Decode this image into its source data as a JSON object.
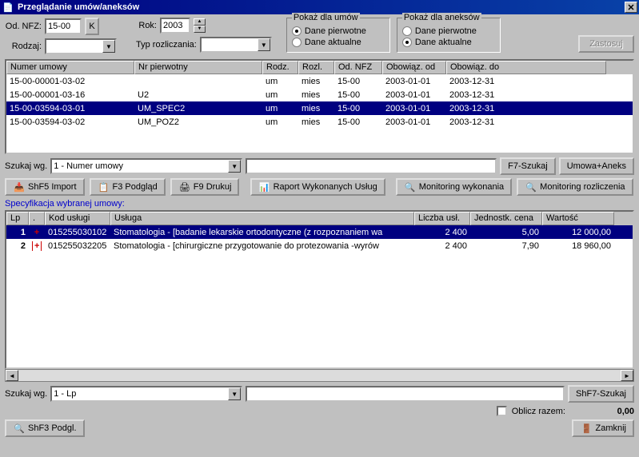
{
  "title": "Przeglądanie umów/aneksów",
  "filters": {
    "od_nfz_label": "Od. NFZ:",
    "od_nfz_value": "15-00",
    "od_nfz_btn": "K",
    "rok_label": "Rok:",
    "rok_value": "2003",
    "rodzaj_label": "Rodzaj:",
    "rodzaj_value": "",
    "typ_label": "Typ rozliczania:",
    "typ_value": ""
  },
  "umowy_box": {
    "legend": "Pokaż dla umów",
    "opt1": "Dane pierwotne",
    "opt2": "Dane aktualne"
  },
  "aneksy_box": {
    "legend": "Pokaż dla aneksów",
    "opt1": "Dane pierwotne",
    "opt2": "Dane aktualne"
  },
  "zastosuj": "Zastosuj",
  "grid1": {
    "headers": [
      "Numer umowy",
      "Nr pierwotny",
      "Rodz.",
      "Rozl.",
      "Od. NFZ",
      "Obowiąz. od",
      "Obowiąz. do"
    ],
    "rows": [
      {
        "c": [
          "15-00-00001-03-02",
          "",
          "um",
          "mies",
          "15-00",
          "2003-01-01",
          "2003-12-31"
        ],
        "sel": false
      },
      {
        "c": [
          "15-00-00001-03-16",
          "U2",
          "um",
          "mies",
          "15-00",
          "2003-01-01",
          "2003-12-31"
        ],
        "sel": false
      },
      {
        "c": [
          "15-00-03594-03-01",
          "UM_SPEC2",
          "um",
          "mies",
          "15-00",
          "2003-01-01",
          "2003-12-31"
        ],
        "sel": true
      },
      {
        "c": [
          "15-00-03594-03-02",
          "UM_POZ2",
          "um",
          "mies",
          "15-00",
          "2003-01-01",
          "2003-12-31"
        ],
        "sel": false
      }
    ]
  },
  "search1": {
    "label": "Szukaj wg.",
    "combo": "1 - Numer umowy",
    "btn_szukaj": "F7-Szukaj",
    "btn_umowa": "Umowa+Aneks"
  },
  "btns1": {
    "import": "ShF5 Import",
    "podglad": "F3 Podgląd",
    "drukuj": "F9 Drukuj",
    "raport": "Raport Wykonanych Usług",
    "mon_wyk": "Monitoring wykonania",
    "mon_roz": "Monitoring rozliczenia"
  },
  "spec_label": "Specyfikacja wybranej umowy:",
  "grid2": {
    "headers": [
      "Lp",
      ".",
      "Kod usługi",
      "Usługa",
      "Liczba usł.",
      "Jednostk. cena",
      "Wartość"
    ],
    "rows": [
      {
        "c": [
          "1",
          "+",
          "015255030102",
          "Stomatologia - [badanie lekarskie ortodontyczne (z rozpoznaniem wa",
          "2 400",
          "5,00",
          "12 000,00"
        ],
        "sel": true,
        "plus": "red"
      },
      {
        "c": [
          "2",
          "+",
          "015255032205",
          "Stomatologia - [chirurgiczne przygotowanie do protezowania -wyrów",
          "2 400",
          "7,90",
          "18 960,00"
        ],
        "sel": false,
        "plus": "redbox"
      }
    ]
  },
  "search2": {
    "label": "Szukaj wg.",
    "combo": "1 - Lp",
    "btn": "ShF7-Szukaj"
  },
  "oblicz": "Oblicz razem:",
  "oblicz_val": "0,00",
  "bottom": {
    "podgl": "ShF3 Podgl.",
    "zamknij": "Zamknij"
  }
}
